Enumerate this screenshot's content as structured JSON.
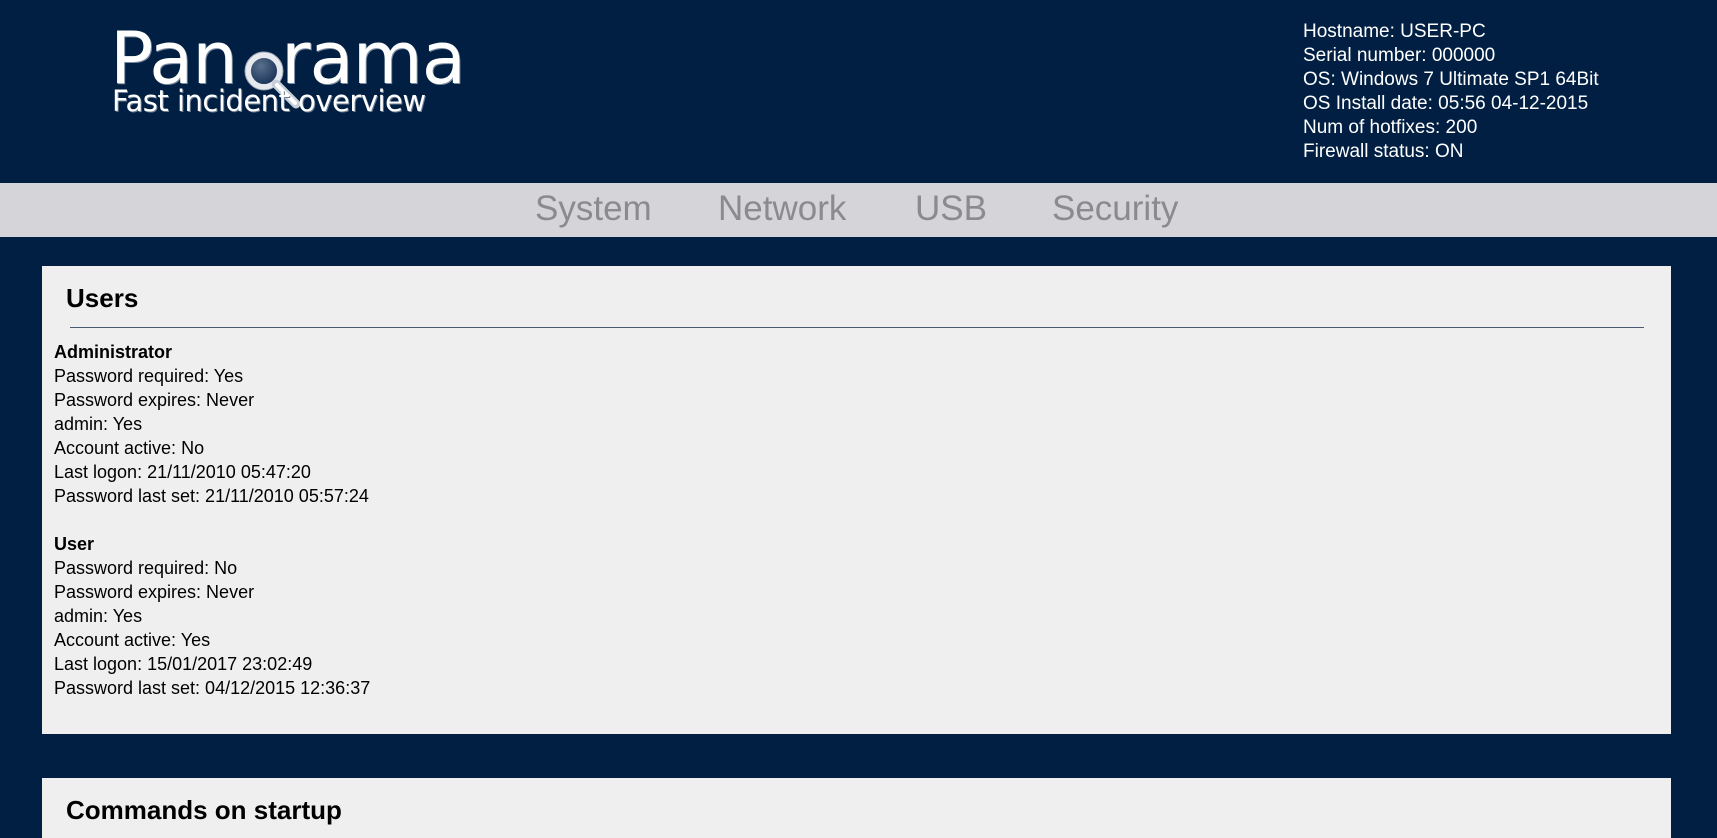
{
  "logo": {
    "title_left": "Pan",
    "title_right": "rama",
    "subtitle": "Fast incident overview",
    "icon": "magnifier-icon"
  },
  "sysinfo": {
    "hostname": "Hostname: USER-PC",
    "serial": "Serial number: 000000",
    "os": "OS: Windows 7 Ultimate SP1 64Bit",
    "install_date": "OS Install date: 05:56 04-12-2015",
    "hotfixes": "Num of hotfixes: 200",
    "firewall": "Firewall status: ON"
  },
  "nav": {
    "items": [
      {
        "label": "System"
      },
      {
        "label": "Network"
      },
      {
        "label": "USB"
      },
      {
        "label": "Security"
      }
    ]
  },
  "users_panel": {
    "title": "Users",
    "users": [
      {
        "name": "Administrator",
        "password_required": "Password required: Yes",
        "password_expires": "Password expires: Never",
        "admin": "admin: Yes",
        "account_active": "Account active: No",
        "last_logon": "Last logon: 21/11/2010 05:47:20",
        "password_last_set": "Password last set: 21/11/2010 05:57:24"
      },
      {
        "name": "User",
        "password_required": "Password required: No",
        "password_expires": "Password expires: Never",
        "admin": "admin: Yes",
        "account_active": "Account active: Yes",
        "last_logon": "Last logon: 15/01/2017 23:02:49",
        "password_last_set": "Password last set: 04/12/2015 12:36:37"
      }
    ]
  },
  "startup_panel": {
    "title": "Commands on startup"
  },
  "colors": {
    "background": "#001f42",
    "navbar": "#d5d4d9",
    "nav_text": "#8a8a8f",
    "panel": "#efefef"
  }
}
